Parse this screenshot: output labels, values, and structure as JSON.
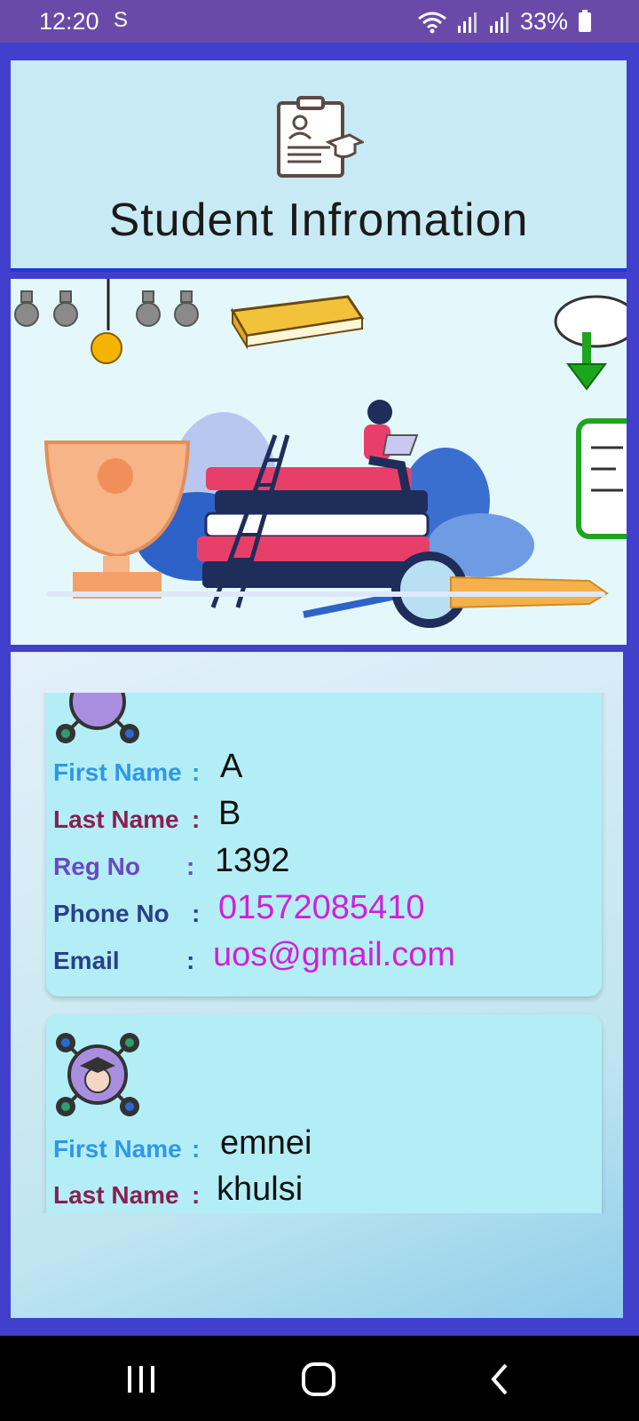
{
  "status_bar": {
    "time": "12:20",
    "carrier_icon": "S",
    "battery": "33%"
  },
  "header": {
    "title": "Student Infromation"
  },
  "labels": {
    "first_name": "First Name",
    "last_name": "Last Name",
    "reg_no": "Reg No",
    "phone_no": "Phone No",
    "email": "Email",
    "colon": ":"
  },
  "students": [
    {
      "first_name": "A",
      "last_name": "B",
      "reg_no": "1392",
      "phone_no": "01572085410",
      "email": "uos@gmail.com"
    },
    {
      "first_name": "emnei",
      "last_name": "khulsi"
    }
  ],
  "colors": {
    "first_name_label": "#2f97e8",
    "last_name_label": "#8a1f52",
    "reg_no_label": "#6a48c4",
    "phone_no_label": "#2a3f8c",
    "email_label": "#2a3f8c",
    "accent_value": "#d21fd9"
  }
}
